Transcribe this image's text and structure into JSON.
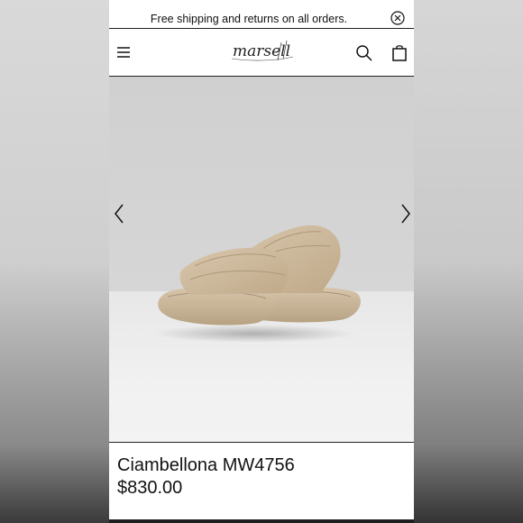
{
  "announcement": {
    "text": "Free shipping and returns on all orders."
  },
  "header": {
    "logo_text": "marsell",
    "menu_icon": "hamburger-menu-icon",
    "search_icon": "search-icon",
    "bag_icon": "shopping-bag-icon"
  },
  "gallery": {
    "prev_icon": "chevron-left-icon",
    "next_icon": "chevron-right-icon",
    "image_subject": "beige padded platform slide sandals"
  },
  "product": {
    "name": "Ciambellona MW4756",
    "price": "$830.00"
  },
  "colors": {
    "text": "#111111",
    "background": "#ffffff",
    "sandal": "#cdb89a"
  }
}
